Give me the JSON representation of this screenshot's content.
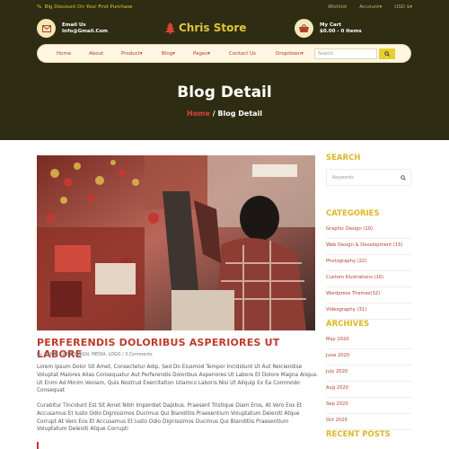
{
  "topbar": {
    "promo": "Big Discount On Your First Purchase",
    "wishlist": "Wishlist",
    "account": "Account",
    "currency": "USD $"
  },
  "header": {
    "email_label": "Email Us",
    "email_value": "Info@Gmail.Com",
    "logo": "Chris Store",
    "cart_label": "My Cart",
    "cart_value": "$0.00 - 0 Items"
  },
  "nav": {
    "items": [
      "Home",
      "About",
      "Product",
      "Blog",
      "Pages",
      "Contact Us",
      "Dropdown"
    ],
    "search_placeholder": "Search"
  },
  "banner": {
    "title": "Blog Detail",
    "crumb_home": "Home",
    "crumb_sep": " / ",
    "crumb_current": "Blog Detail"
  },
  "post": {
    "title": "PERFERENDIS DOLORIBUS ASPERIORES UT LABORE",
    "meta": "By ADMIN / WEBDESIGN, MEDIA, LOGO / 3 Comments",
    "para1": "Lorem Ipsum Dolor Sit Amet, Consectetur Adip, Sed Do Eiusmod Tempor Incididunt Ut Aut Reiciendise Voluptat Maiores Alias Consequatur Aut Perferendis Doloribus Asperiores Ut Labore Et Dolore Magna Aliqua. Ut Enim Ad Minim Veniam, Quis Nostrud Exercitation Ullamco Laboris Nisi Ut Aliquip Ex Ea Commodo Consequat",
    "para2": "Curabitur Tincidunt Est Sit Amet Nibh Imperdiet Dapibus. Praesent Tristique Diam Eros, At Vero Eos Et Accusamus Et Iusto Odio Dignissimos Ducimus Qui Blanditiis Praesentium Voluptatum Deleniti Atque Corrupt At Vero Eos Et Accusamus Et Iusto Odio Dignissimos Ducimus Qui Blanditiis Praesentium Voluptatum Deleniti Atque Corrupti"
  },
  "sidebar": {
    "search_heading": "SEARCH",
    "search_placeholder": "Keywords",
    "categories_heading": "CATEGORIES",
    "categories": [
      "Graphic Design (10)",
      "Web Design & Development (15)",
      "Photography (22)",
      "Custom Illustrations (16)",
      "Wordpress Themes(32)",
      "Videography (31)"
    ],
    "archives_heading": "ARCHIVES",
    "archives": [
      "May 2020",
      "June 2020",
      "July 2020",
      "Aug 2020",
      "Sep 2020",
      "Oct 2020"
    ],
    "recent_heading": "RECENT POSTS"
  },
  "colors": {
    "dark_bg": "#2e2c12",
    "gold": "#e3c53a",
    "accent_red": "#c1392b"
  }
}
